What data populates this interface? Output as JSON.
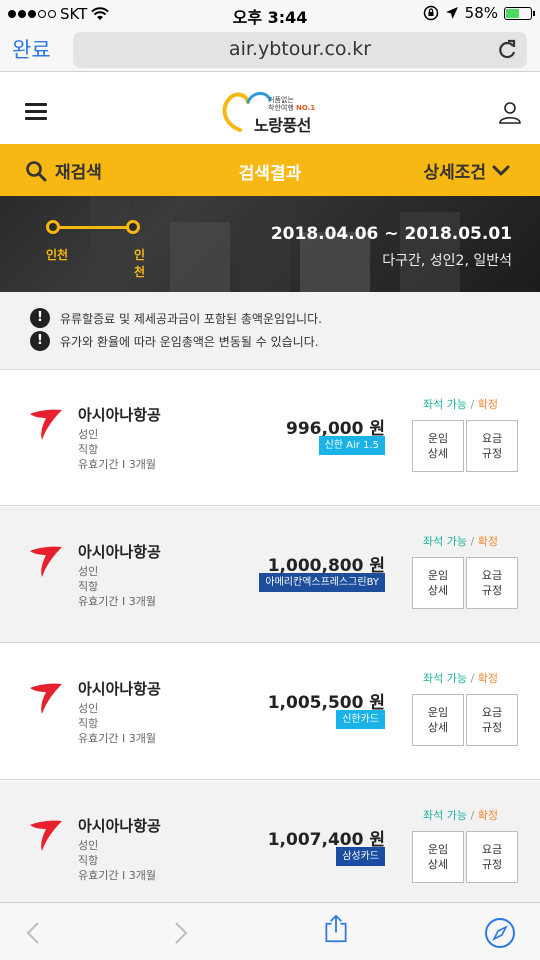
{
  "status_bar": {
    "carrier": "SKT",
    "time": "오후 3:44",
    "battery": "58%",
    "battery_level": 0.58
  },
  "browser": {
    "done_label": "완료",
    "url": "air.ybtour.co.kr"
  },
  "header": {
    "logo_tagline": "거품없는",
    "logo_tagline2": "착한여행",
    "logo_no1": "NO.1",
    "logo_name": "노랑풍선"
  },
  "search_bar": {
    "research_label": "재검색",
    "title": "검색결과",
    "detail_label": "상세조건"
  },
  "trip": {
    "origin": "인천",
    "destination": "인천",
    "dates": "2018.04.06 ~ 2018.05.01",
    "info": "다구간, 성인2, 일반석"
  },
  "notices": [
    "유류할증료 및 제세공과금이 포함된 총액운임입니다.",
    "유가와 환율에 따라 운임총액은 변동될 수 있습니다."
  ],
  "results": [
    {
      "airline": "아시아나항공",
      "pax": "성인",
      "route_type": "직항",
      "validity": "유효기간 I 3개월",
      "price": "996,000 원",
      "badge": "신한 Air 1.5",
      "badge_color": "#19b3e8",
      "avail": "좌석 가능",
      "slash": "/",
      "confirm": "확정",
      "fare_detail": [
        "운임",
        "상세"
      ],
      "fare_rule": [
        "요금",
        "규정"
      ]
    },
    {
      "airline": "아시아나항공",
      "pax": "성인",
      "route_type": "직항",
      "validity": "유효기간 I 3개월",
      "price": "1,000,800 원",
      "badge": "아메리칸엑스프레스그린BY",
      "badge_color": "#1d4e9c",
      "avail": "좌석 가능",
      "slash": "/",
      "confirm": "확정",
      "fare_detail": [
        "운임",
        "상세"
      ],
      "fare_rule": [
        "요금",
        "규정"
      ]
    },
    {
      "airline": "아시아나항공",
      "pax": "성인",
      "route_type": "직항",
      "validity": "유효기간 I 3개월",
      "price": "1,005,500 원",
      "badge": "신한카드",
      "badge_color": "#19b3e8",
      "avail": "좌석 가능",
      "slash": "/",
      "confirm": "확정",
      "fare_detail": [
        "운임",
        "상세"
      ],
      "fare_rule": [
        "요금",
        "규정"
      ]
    },
    {
      "airline": "아시아나항공",
      "pax": "성인",
      "route_type": "직항",
      "validity": "유효기간 I 3개월",
      "price": "1,007,400 원",
      "badge": "삼성카드",
      "badge_color": "#1a4da1",
      "avail": "좌석 가능",
      "slash": "/",
      "confirm": "확정",
      "fare_detail": [
        "운임",
        "상세"
      ],
      "fare_rule": [
        "요금",
        "규정"
      ]
    }
  ],
  "colors": {
    "accent_yellow": "#f8b813",
    "link_blue": "#2a7ae2",
    "airline_red": "#e6202e"
  }
}
